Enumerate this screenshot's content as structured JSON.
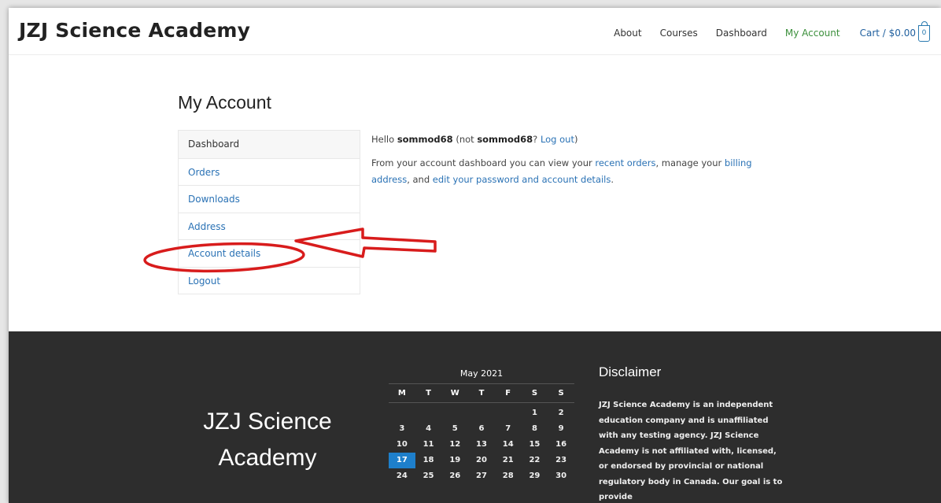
{
  "header": {
    "logo": "JZJ Science Academy",
    "nav": [
      "About",
      "Courses",
      "Dashboard",
      "My Account"
    ],
    "cart_label": "Cart / $0.00",
    "cart_count": "0"
  },
  "main": {
    "title": "My Account",
    "account_nav": [
      "Dashboard",
      "Orders",
      "Downloads",
      "Address",
      "Account details",
      "Logout"
    ],
    "greeting": {
      "hello": "Hello ",
      "user": "sommod68",
      "not_open": " (not ",
      "not_user": "sommod68",
      "q": "? ",
      "logout": "Log out",
      "close": ")"
    },
    "intro": {
      "t1": "From your account dashboard you can view your ",
      "l1": "recent orders",
      "t2": ", manage your ",
      "l2": "billing address",
      "t3": ", and ",
      "l3": "edit your password and account details",
      "t4": "."
    }
  },
  "footer": {
    "brand": "JZJ Science Academy",
    "calendar": {
      "caption": "May 2021",
      "weekdays": [
        "M",
        "T",
        "W",
        "T",
        "F",
        "S",
        "S"
      ],
      "first_weekday_index": 5,
      "days": [
        "1",
        "2",
        "3",
        "4",
        "5",
        "6",
        "7",
        "8",
        "9",
        "10",
        "11",
        "12",
        "13",
        "14",
        "15",
        "16",
        "17",
        "18",
        "19",
        "20",
        "21",
        "22",
        "23",
        "24",
        "25",
        "26",
        "27",
        "28",
        "29",
        "30"
      ],
      "today": "17"
    },
    "disclaimer": {
      "title": "Disclaimer",
      "text": "JZJ Science Academy is an independent education company and is unaffiliated with any testing agency. JZJ Science Academy is not affiliated with, licensed, or endorsed by provincial or national regulatory body in Canada. Our goal is to provide"
    }
  },
  "colors": {
    "link": "#2a72b5",
    "active_nav": "#3b8f3b",
    "footer_bg": "#2d2d2d",
    "today": "#1e7fcb",
    "annotation": "#d81c1c"
  }
}
